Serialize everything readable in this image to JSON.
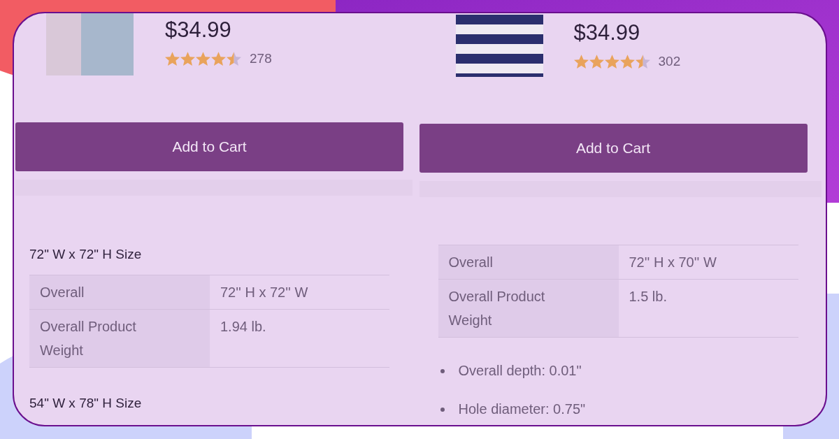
{
  "products": [
    {
      "price": "$34.99",
      "stars": 4.5,
      "review_count": "278",
      "button": "Add to Cart",
      "spec_sections": [
        {
          "heading": "72\" W x 72\" H Size",
          "rows": [
            {
              "label": "Overall",
              "value": "72'' H x 72'' W"
            },
            {
              "label": "Overall Product Weight",
              "value": "1.94 lb."
            }
          ]
        },
        {
          "heading": "54\" W x 78\" H Size"
        }
      ]
    },
    {
      "price": "$34.99",
      "stars": 4.5,
      "review_count": "302",
      "button": "Add to Cart",
      "spec_sections": [
        {
          "rows": [
            {
              "label": "Overall",
              "value": "72'' H x 70'' W"
            },
            {
              "label": "Overall Product Weight",
              "value": "1.5 lb."
            }
          ]
        }
      ],
      "bullets": [
        "Overall depth: 0.01\"",
        "Hole diameter: 0.75\""
      ]
    }
  ]
}
